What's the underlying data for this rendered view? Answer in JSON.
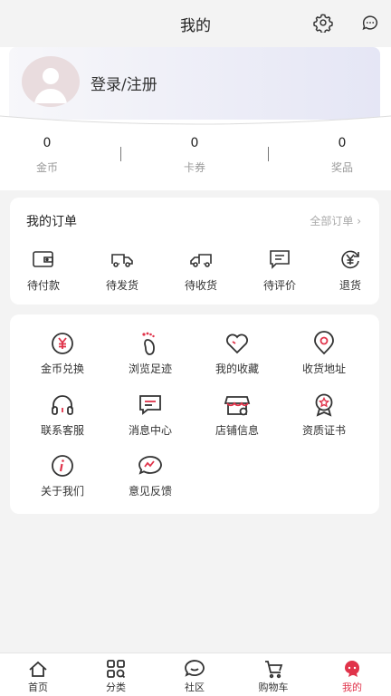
{
  "header": {
    "title": "我的",
    "settings_icon": "gear-icon",
    "message_icon": "chat-bubble-icon"
  },
  "profile": {
    "login_label": "登录/注册",
    "avatar_icon": "default-avatar-icon"
  },
  "stats": [
    {
      "value": "0",
      "label": "金币"
    },
    {
      "value": "0",
      "label": "卡券"
    },
    {
      "value": "0",
      "label": "奖品"
    }
  ],
  "orders": {
    "title": "我的订单",
    "view_all": "全部订单",
    "items": [
      {
        "label": "待付款",
        "icon": "wallet-icon"
      },
      {
        "label": "待发货",
        "icon": "truck-icon"
      },
      {
        "label": "待收货",
        "icon": "truck-icon"
      },
      {
        "label": "待评价",
        "icon": "comment-icon"
      },
      {
        "label": "退货",
        "icon": "refund-icon"
      }
    ]
  },
  "services": [
    {
      "label": "金币兑换",
      "icon": "coin-icon"
    },
    {
      "label": "浏览足迹",
      "icon": "footprint-icon"
    },
    {
      "label": "我的收藏",
      "icon": "heart-icon"
    },
    {
      "label": "收货地址",
      "icon": "location-icon"
    },
    {
      "label": "联系客服",
      "icon": "headset-icon"
    },
    {
      "label": "消息中心",
      "icon": "message-icon"
    },
    {
      "label": "店铺信息",
      "icon": "store-icon"
    },
    {
      "label": "资质证书",
      "icon": "certificate-icon"
    },
    {
      "label": "关于我们",
      "icon": "info-icon"
    },
    {
      "label": "意见反馈",
      "icon": "feedback-icon"
    }
  ],
  "tabbar": [
    {
      "label": "首页",
      "icon": "home-icon"
    },
    {
      "label": "分类",
      "icon": "category-icon"
    },
    {
      "label": "社区",
      "icon": "community-icon"
    },
    {
      "label": "购物车",
      "icon": "cart-icon"
    },
    {
      "label": "我的",
      "icon": "profile-icon",
      "active": true
    }
  ],
  "colors": {
    "accent": "#e0334a",
    "icon_stroke": "#333333"
  }
}
